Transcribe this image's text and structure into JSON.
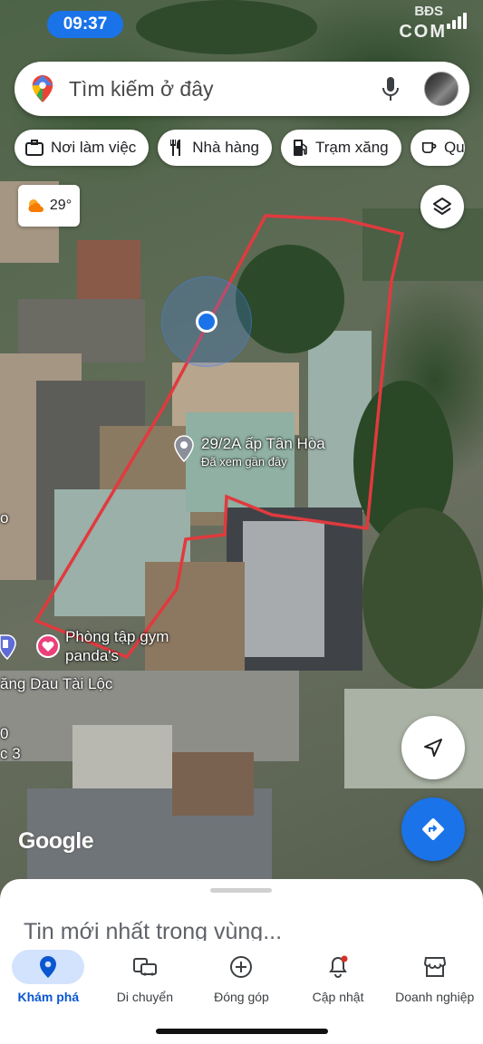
{
  "status_bar": {
    "time": "09:37"
  },
  "watermark": {
    "top": "BĐS",
    "bottom": "COM"
  },
  "search": {
    "placeholder": "Tìm kiếm ở đây"
  },
  "chips": [
    {
      "label": "Nơi làm việc",
      "icon": "briefcase-icon"
    },
    {
      "label": "Nhà hàng",
      "icon": "fork-knife-icon"
    },
    {
      "label": "Trạm xăng",
      "icon": "gas-station-icon"
    },
    {
      "label": "Qu",
      "icon": "cup-icon"
    }
  ],
  "weather": {
    "temp": "29°",
    "icon": "partly-sunny-icon"
  },
  "map": {
    "selected_place": {
      "title": "29/2A ấp Tân Hòa",
      "subtitle": "Đã xem gần đây"
    },
    "gym": {
      "line1": "Phòng tập gym",
      "line2": "panda's"
    },
    "gas_station": "ăng Dau Tài Lộc",
    "edge_label_1": "0",
    "edge_label_2": "c 3",
    "boundary_color": "#e03a3e",
    "logo": "Google"
  },
  "bottom_sheet": {
    "title": "Tin mới nhất trong vùng..."
  },
  "bottom_nav": [
    {
      "label": "Khám phá",
      "icon": "explore-pin-icon",
      "active": true
    },
    {
      "label": "Di chuyển",
      "icon": "commute-icon",
      "active": false
    },
    {
      "label": "Đóng góp",
      "icon": "contribute-plus-icon",
      "active": false
    },
    {
      "label": "Cập nhật",
      "icon": "bell-icon",
      "active": false
    },
    {
      "label": "Doanh nghiệp",
      "icon": "storefront-icon",
      "active": false
    }
  ],
  "colors": {
    "accent": "#1a73e8",
    "active_nav_bg": "#d3e3fd"
  }
}
